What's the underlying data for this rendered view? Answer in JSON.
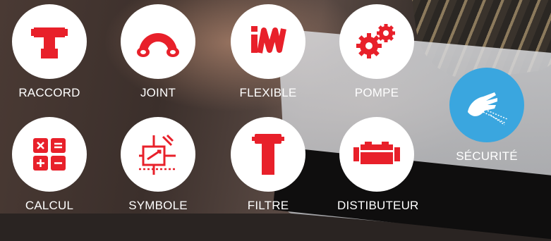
{
  "tiles": [
    {
      "label": "RACCORD",
      "icon": "fitting-icon"
    },
    {
      "label": "JOINT",
      "icon": "seal-icon"
    },
    {
      "label": "FLEXIBLE",
      "icon": "hose-icon"
    },
    {
      "label": "POMPE",
      "icon": "gears-icon"
    },
    {
      "label": "SÉCURITÉ",
      "icon": "safety-hand-icon"
    },
    {
      "label": "CALCUL",
      "icon": "calculator-icon"
    },
    {
      "label": "SYMBOLE",
      "icon": "symbol-icon"
    },
    {
      "label": "FILTRE",
      "icon": "filter-icon"
    },
    {
      "label": "DISTIBUTEUR",
      "icon": "distributor-icon"
    }
  ],
  "colors": {
    "accent": "#e8202a",
    "safety": "#3aa6df",
    "circle": "#ffffff"
  }
}
